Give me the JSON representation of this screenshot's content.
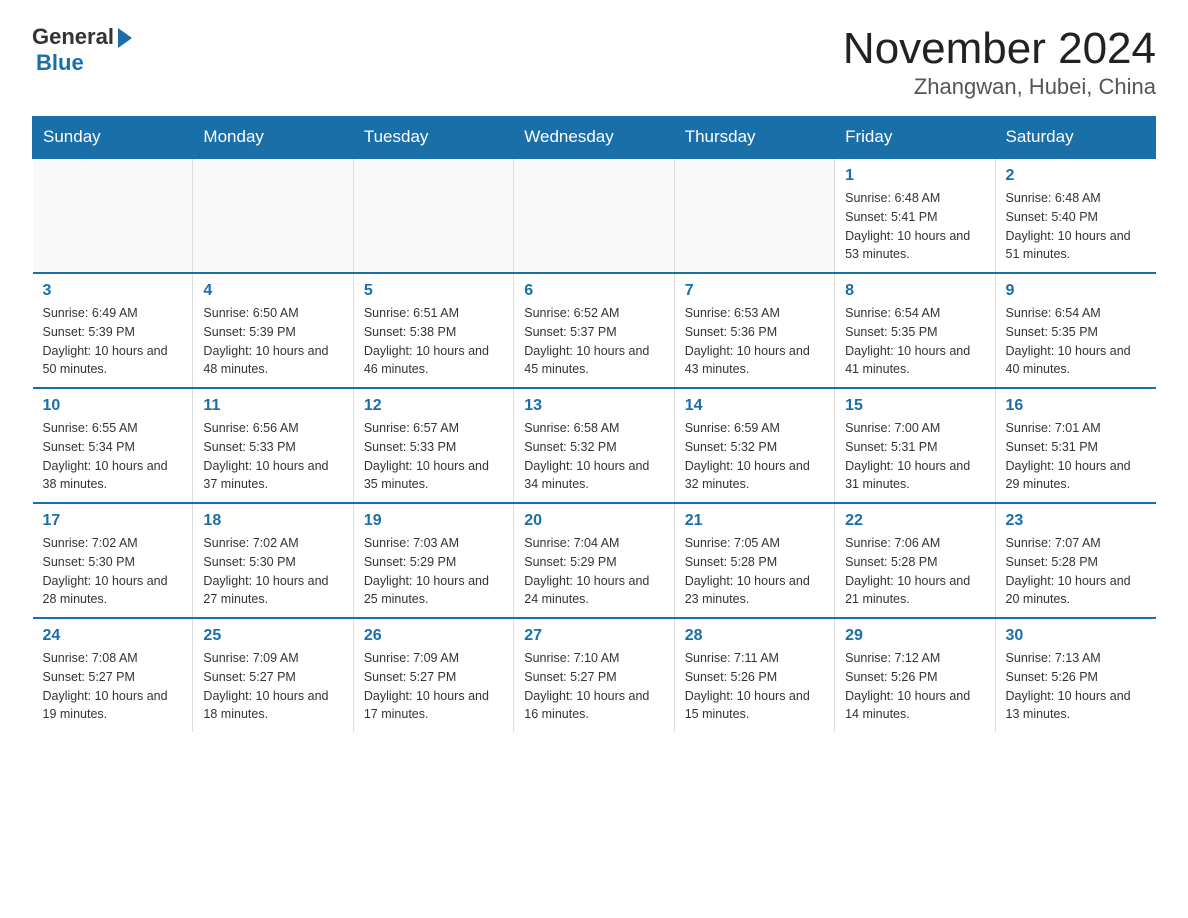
{
  "header": {
    "logo_general": "General",
    "logo_blue": "Blue",
    "title": "November 2024",
    "subtitle": "Zhangwan, Hubei, China"
  },
  "days_of_week": [
    "Sunday",
    "Monday",
    "Tuesday",
    "Wednesday",
    "Thursday",
    "Friday",
    "Saturday"
  ],
  "weeks": [
    [
      {
        "day": "",
        "info": ""
      },
      {
        "day": "",
        "info": ""
      },
      {
        "day": "",
        "info": ""
      },
      {
        "day": "",
        "info": ""
      },
      {
        "day": "",
        "info": ""
      },
      {
        "day": "1",
        "info": "Sunrise: 6:48 AM\nSunset: 5:41 PM\nDaylight: 10 hours and 53 minutes."
      },
      {
        "day": "2",
        "info": "Sunrise: 6:48 AM\nSunset: 5:40 PM\nDaylight: 10 hours and 51 minutes."
      }
    ],
    [
      {
        "day": "3",
        "info": "Sunrise: 6:49 AM\nSunset: 5:39 PM\nDaylight: 10 hours and 50 minutes."
      },
      {
        "day": "4",
        "info": "Sunrise: 6:50 AM\nSunset: 5:39 PM\nDaylight: 10 hours and 48 minutes."
      },
      {
        "day": "5",
        "info": "Sunrise: 6:51 AM\nSunset: 5:38 PM\nDaylight: 10 hours and 46 minutes."
      },
      {
        "day": "6",
        "info": "Sunrise: 6:52 AM\nSunset: 5:37 PM\nDaylight: 10 hours and 45 minutes."
      },
      {
        "day": "7",
        "info": "Sunrise: 6:53 AM\nSunset: 5:36 PM\nDaylight: 10 hours and 43 minutes."
      },
      {
        "day": "8",
        "info": "Sunrise: 6:54 AM\nSunset: 5:35 PM\nDaylight: 10 hours and 41 minutes."
      },
      {
        "day": "9",
        "info": "Sunrise: 6:54 AM\nSunset: 5:35 PM\nDaylight: 10 hours and 40 minutes."
      }
    ],
    [
      {
        "day": "10",
        "info": "Sunrise: 6:55 AM\nSunset: 5:34 PM\nDaylight: 10 hours and 38 minutes."
      },
      {
        "day": "11",
        "info": "Sunrise: 6:56 AM\nSunset: 5:33 PM\nDaylight: 10 hours and 37 minutes."
      },
      {
        "day": "12",
        "info": "Sunrise: 6:57 AM\nSunset: 5:33 PM\nDaylight: 10 hours and 35 minutes."
      },
      {
        "day": "13",
        "info": "Sunrise: 6:58 AM\nSunset: 5:32 PM\nDaylight: 10 hours and 34 minutes."
      },
      {
        "day": "14",
        "info": "Sunrise: 6:59 AM\nSunset: 5:32 PM\nDaylight: 10 hours and 32 minutes."
      },
      {
        "day": "15",
        "info": "Sunrise: 7:00 AM\nSunset: 5:31 PM\nDaylight: 10 hours and 31 minutes."
      },
      {
        "day": "16",
        "info": "Sunrise: 7:01 AM\nSunset: 5:31 PM\nDaylight: 10 hours and 29 minutes."
      }
    ],
    [
      {
        "day": "17",
        "info": "Sunrise: 7:02 AM\nSunset: 5:30 PM\nDaylight: 10 hours and 28 minutes."
      },
      {
        "day": "18",
        "info": "Sunrise: 7:02 AM\nSunset: 5:30 PM\nDaylight: 10 hours and 27 minutes."
      },
      {
        "day": "19",
        "info": "Sunrise: 7:03 AM\nSunset: 5:29 PM\nDaylight: 10 hours and 25 minutes."
      },
      {
        "day": "20",
        "info": "Sunrise: 7:04 AM\nSunset: 5:29 PM\nDaylight: 10 hours and 24 minutes."
      },
      {
        "day": "21",
        "info": "Sunrise: 7:05 AM\nSunset: 5:28 PM\nDaylight: 10 hours and 23 minutes."
      },
      {
        "day": "22",
        "info": "Sunrise: 7:06 AM\nSunset: 5:28 PM\nDaylight: 10 hours and 21 minutes."
      },
      {
        "day": "23",
        "info": "Sunrise: 7:07 AM\nSunset: 5:28 PM\nDaylight: 10 hours and 20 minutes."
      }
    ],
    [
      {
        "day": "24",
        "info": "Sunrise: 7:08 AM\nSunset: 5:27 PM\nDaylight: 10 hours and 19 minutes."
      },
      {
        "day": "25",
        "info": "Sunrise: 7:09 AM\nSunset: 5:27 PM\nDaylight: 10 hours and 18 minutes."
      },
      {
        "day": "26",
        "info": "Sunrise: 7:09 AM\nSunset: 5:27 PM\nDaylight: 10 hours and 17 minutes."
      },
      {
        "day": "27",
        "info": "Sunrise: 7:10 AM\nSunset: 5:27 PM\nDaylight: 10 hours and 16 minutes."
      },
      {
        "day": "28",
        "info": "Sunrise: 7:11 AM\nSunset: 5:26 PM\nDaylight: 10 hours and 15 minutes."
      },
      {
        "day": "29",
        "info": "Sunrise: 7:12 AM\nSunset: 5:26 PM\nDaylight: 10 hours and 14 minutes."
      },
      {
        "day": "30",
        "info": "Sunrise: 7:13 AM\nSunset: 5:26 PM\nDaylight: 10 hours and 13 minutes."
      }
    ]
  ]
}
